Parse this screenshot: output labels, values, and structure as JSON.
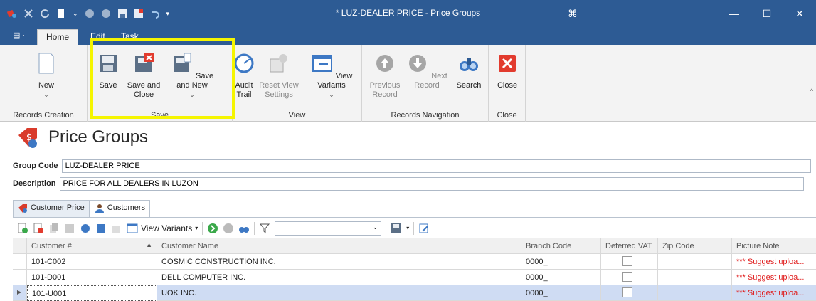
{
  "window": {
    "title": "* LUZ-DEALER PRICE - Price Groups",
    "minimize": "—",
    "maximize": "☐",
    "close": "✕",
    "restore": "⌘"
  },
  "ribbon_tabs": [
    {
      "label": "Home"
    },
    {
      "label": "Edit"
    },
    {
      "label": "Task"
    }
  ],
  "ribbon": {
    "records_creation": {
      "label": "Records Creation",
      "new": "New"
    },
    "save": {
      "label": "Save",
      "save": "Save",
      "save_close_1": "Save and",
      "save_close_2": "Close",
      "save_new": "Save and New"
    },
    "view": {
      "label": "View",
      "audit_1": "Audit",
      "audit_2": "Trail",
      "reset_1": "Reset View",
      "reset_2": "Settings",
      "variants": "View Variants"
    },
    "records_navigation": {
      "label": "Records Navigation",
      "prev_1": "Previous",
      "prev_2": "Record",
      "next": "Next Record",
      "search": "Search"
    },
    "close": {
      "label": "Close",
      "close": "Close"
    }
  },
  "page": {
    "title": "Price Groups"
  },
  "form": {
    "group_code_label": "Group Code",
    "group_code_value": "LUZ-DEALER PRICE",
    "description_label": "Description",
    "description_value": "PRICE FOR ALL DEALERS IN LUZON"
  },
  "tabs": [
    {
      "label": "Customer Price"
    },
    {
      "label": "Customers"
    }
  ],
  "grid_toolbar": {
    "view_variants": "View Variants"
  },
  "grid": {
    "columns": [
      "Customer #",
      "Customer Name",
      "Branch Code",
      "Deferred VAT",
      "Zip Code",
      "Picture Note"
    ],
    "rows": [
      {
        "customer_no": "101-C002",
        "customer_name": "COSMIC CONSTRUCTION INC.",
        "branch_code": "0000_",
        "zip": "",
        "note": "*** Suggest uploa..."
      },
      {
        "customer_no": "101-D001",
        "customer_name": "DELL COMPUTER INC.",
        "branch_code": "0000_",
        "zip": "",
        "note": "*** Suggest uploa..."
      },
      {
        "customer_no": "101-U001",
        "customer_name": "UOK INC.",
        "branch_code": "0000_",
        "zip": "",
        "note": "*** Suggest uploa..."
      }
    ]
  },
  "colors": {
    "titlebar": "#2d5b94",
    "highlight": "#f5f500",
    "selected_row": "#cfdcf3",
    "note_red": "#e01b1b"
  }
}
